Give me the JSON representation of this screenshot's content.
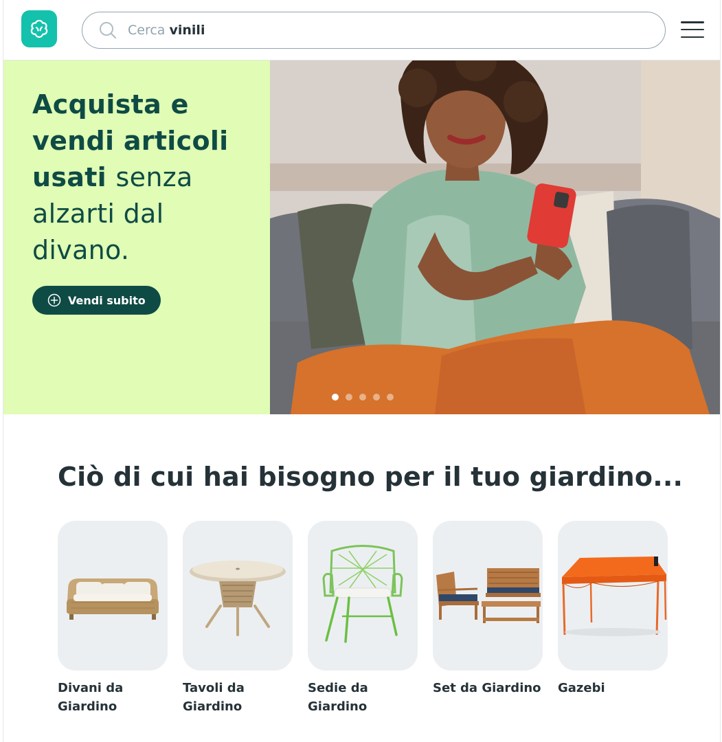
{
  "header": {
    "logo_icon": "wallapop-logo-icon",
    "search": {
      "placeholder_prefix": "Cerca",
      "placeholder_term": "vinili"
    },
    "menu_icon": "hamburger-menu-icon"
  },
  "hero": {
    "title_bold": "Acquista e vendi articoli usati",
    "title_light": "senza alzarti dal divano.",
    "cta_label": "Vendi subito",
    "cta_icon": "plus-circle-icon",
    "background_color": "#e0fcb5",
    "carousel": {
      "total": 5,
      "active": 1
    }
  },
  "section": {
    "title": "Ciò di cui hai bisogno per il tuo giardino..."
  },
  "categories": [
    {
      "label": "Divani da Giardino",
      "icon": "garden-sofa-image"
    },
    {
      "label": "Tavoli da Giardino",
      "icon": "garden-table-image"
    },
    {
      "label": "Sedie da Giardino",
      "icon": "garden-chair-image"
    },
    {
      "label": "Set da Giardino",
      "icon": "garden-set-image"
    },
    {
      "label": "Gazebi",
      "icon": "gazebo-image"
    }
  ],
  "colors": {
    "brand": "#13c1ac",
    "dark_green": "#0f4b45",
    "text": "#253238"
  }
}
